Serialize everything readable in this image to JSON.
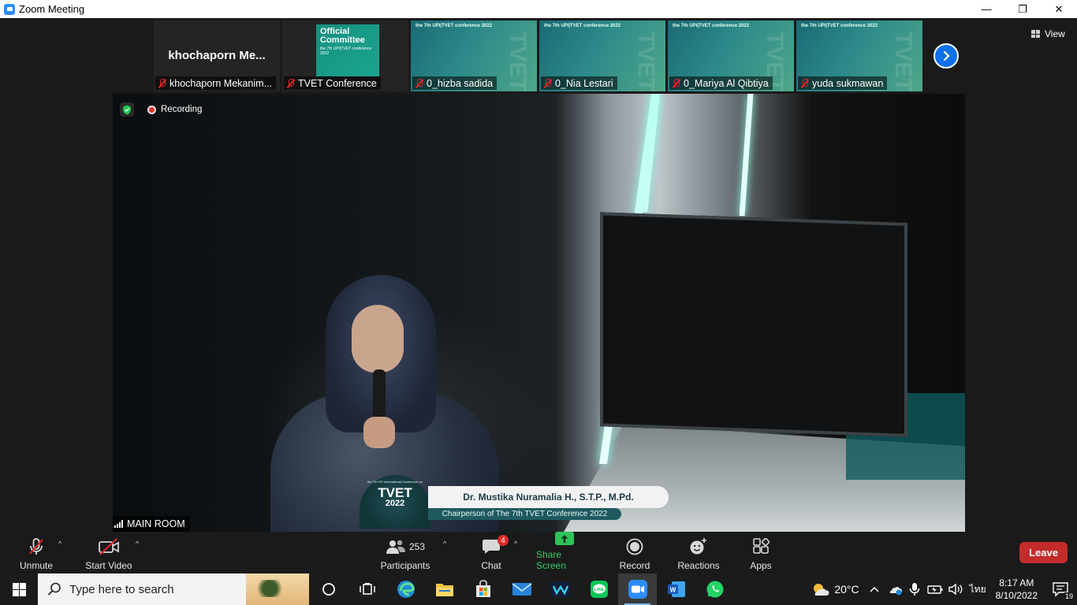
{
  "window": {
    "title": "Zoom Meeting",
    "minimize_glyph": "—",
    "restore_glyph": "❐",
    "close_glyph": "✕"
  },
  "thumbnails": [
    {
      "display_name": "khochaporn  Me...",
      "label": "khochaporn Mekanim...",
      "muted": true,
      "kind": "name"
    },
    {
      "label": "TVET Conference",
      "muted": true,
      "kind": "committee",
      "slide_title": "Official Committee",
      "slide_sub": "the 7th UPI|TVET conference 2022"
    },
    {
      "label": "0_hizba sadida",
      "muted": true,
      "kind": "slide",
      "slide_text": "the 7th UPI|TVET conference 2022"
    },
    {
      "label": "0_Nia Lestari",
      "muted": true,
      "kind": "slide",
      "slide_text": "the 7th UPI|TVET conference 2022"
    },
    {
      "label": "0_Mariya Al Qibtiya",
      "muted": true,
      "kind": "slide",
      "slide_text": "the 7th UPI|TVET conference 2022"
    },
    {
      "label": "yuda sukmawan",
      "muted": true,
      "kind": "slide",
      "slide_text": "the 7th UPI|TVET conference 2022"
    }
  ],
  "view_button": {
    "label": "View"
  },
  "speaker": {
    "recording_label": "Recording",
    "lower_third_logo": {
      "line1": "the 7th UPI International Conference on",
      "tvet": "TVET",
      "year": "2022"
    },
    "lower_third_name": "Dr. Mustika Nuramalia H., S.T.P., M.Pd.",
    "lower_third_role": "Chairperson of The 7th TVET Conference 2022",
    "room_label": "MAIN ROOM"
  },
  "toolbar": {
    "unmute": "Unmute",
    "start_video": "Start Video",
    "participants": "Participants",
    "participant_count": "253",
    "chat": "Chat",
    "chat_badge": "4",
    "share_screen": "Share Screen",
    "record": "Record",
    "reactions": "Reactions",
    "apps": "Apps",
    "leave": "Leave",
    "caret": "^"
  },
  "taskbar": {
    "search_placeholder": "Type here to search",
    "weather_temp": "20°C",
    "language": "ไทย",
    "time": "8:17 AM",
    "date": "8/10/2022",
    "notification_count": "19"
  },
  "colors": {
    "zoom_blue": "#0e71eb",
    "share_green": "#2ec35a",
    "leave_red": "#c42b2b",
    "muted_red": "#e02828"
  }
}
